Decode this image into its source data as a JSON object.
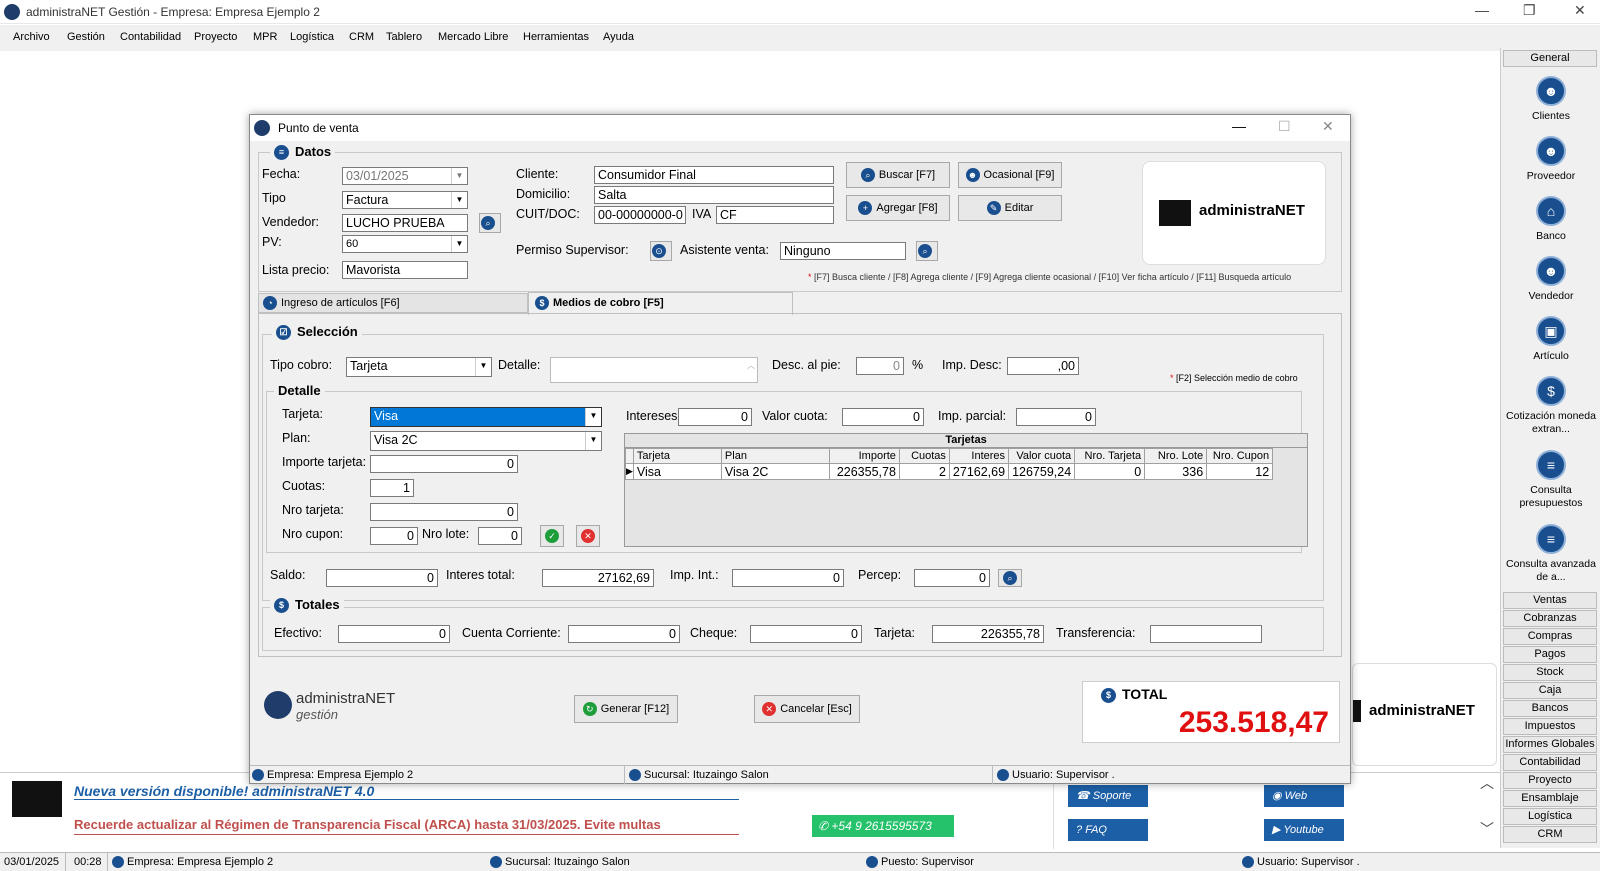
{
  "app": {
    "title": "administraNET Gestión - Empresa: Empresa Ejemplo 2"
  },
  "menu": [
    "Archivo",
    "Gestión",
    "Contabilidad",
    "Proyecto",
    "MPR",
    "Logística",
    "CRM",
    "Tablero",
    "Mercado Libre",
    "Herramientas",
    "Ayuda"
  ],
  "sidebar": {
    "header": "General",
    "items": [
      {
        "label": "Clientes"
      },
      {
        "label": "Proveedor"
      },
      {
        "label": "Banco"
      },
      {
        "label": "Vendedor"
      },
      {
        "label": "Artículo"
      },
      {
        "label": "Cotización moneda extran..."
      },
      {
        "label": "Consulta presupuestos"
      },
      {
        "label": "Consulta avanzada de a..."
      }
    ],
    "buttons": [
      "Ventas",
      "Cobranzas",
      "Compras",
      "Pagos",
      "Stock",
      "Caja",
      "Bancos",
      "Impuestos",
      "Informes Globales",
      "Contabilidad",
      "Proyecto",
      "Ensamblaje",
      "Logística",
      "CRM"
    ]
  },
  "window": {
    "title": "Punto de venta"
  },
  "datos": {
    "section": "Datos",
    "fecha_label": "Fecha:",
    "fecha": "03/01/2025",
    "tipo_label": "Tipo",
    "tipo": "Factura",
    "vendedor_label": "Vendedor:",
    "vendedor": "LUCHO PRUEBA",
    "pv_label": "PV:",
    "pv": "60",
    "lista_label": "Lista precio:",
    "lista": "Mavorista",
    "cliente_label": "Cliente:",
    "cliente": "Consumidor Final",
    "domicilio_label": "Domicilio:",
    "domicilio": "Salta",
    "cuit_label": "CUIT/DOC:",
    "cuit": "00-00000000-0",
    "iva_label": "IVA",
    "iva": "CF",
    "permiso_label": "Permiso Supervisor:",
    "asistente_label": "Asistente venta:",
    "asistente": "Ninguno",
    "btn_buscar": "Buscar [F7]",
    "btn_ocasional": "Ocasional [F9]",
    "btn_agregar": "Agregar [F8]",
    "btn_editar": "Editar",
    "hint": "[F7] Busca cliente / [F8] Agrega cliente / [F9] Agrega cliente ocasional / [F10] Ver ficha artículo / [F11] Busqueda artículo",
    "logo": "administraNET"
  },
  "tabs": [
    {
      "label": "Ingreso de artículos [F6]"
    },
    {
      "label": "Medios de cobro [F5]"
    }
  ],
  "seleccion": {
    "section": "Selección",
    "tipo_cobro_label": "Tipo cobro:",
    "tipo_cobro": "Tarjeta",
    "detalle_label": "Detalle:",
    "desc_label": "Desc. al pie:",
    "desc": "0",
    "pct": "%",
    "imp_desc_label": "Imp. Desc:",
    "imp_desc": ",00",
    "hint": "[F2] Selección medio de cobro"
  },
  "detalle": {
    "section": "Detalle",
    "tarjeta_label": "Tarjeta:",
    "tarjeta": "Visa",
    "plan_label": "Plan:",
    "plan": "Visa 2C",
    "importe_label": "Importe tarjeta:",
    "importe": "0",
    "cuotas_label": "Cuotas:",
    "cuotas": "1",
    "nro_tarjeta_label": "Nro tarjeta:",
    "nro_tarjeta": "0",
    "nro_cupon_label": "Nro cupon:",
    "nro_cupon": "0",
    "nro_lote_label": "Nro lote:",
    "nro_lote": "0",
    "intereses_label": "Intereses:",
    "intereses": "0",
    "valor_cuota_label": "Valor cuota:",
    "valor_cuota": "0",
    "imp_parcial_label": "Imp. parcial:",
    "imp_parcial": "0"
  },
  "tarjetas_table": {
    "title": "Tarjetas",
    "columns": [
      "Tarjeta",
      "Plan",
      "Importe",
      "Cuotas",
      "Interes",
      "Valor cuota",
      "Nro. Tarjeta",
      "Nro. Lote",
      "Nro. Cupon"
    ],
    "rows": [
      [
        "Visa",
        "Visa 2C",
        "226355,78",
        "2",
        "27162,69",
        "126759,24",
        "0",
        "336",
        "12"
      ]
    ]
  },
  "saldo": {
    "saldo_label": "Saldo:",
    "saldo": "0",
    "interes_total_label": "Interes total:",
    "interes_total": "27162,69",
    "imp_int_label": "Imp. Int.:",
    "imp_int": "0",
    "percep_label": "Percep:",
    "percep": "0"
  },
  "totales": {
    "section": "Totales",
    "efectivo_label": "Efectivo:",
    "efectivo": "0",
    "cc_label": "Cuenta Corriente:",
    "cc": "0",
    "cheque_label": "Cheque:",
    "cheque": "0",
    "tarjeta_label": "Tarjeta:",
    "tarjeta": "226355,78",
    "transferencia_label": "Transferencia:",
    "transferencia": ""
  },
  "footer": {
    "logo_top": "administraNET",
    "logo_bottom": "gestión",
    "btn_generar": "Generar [F12]",
    "btn_cancelar": "Cancelar [Esc]",
    "total_label": "TOTAL",
    "total": "253.518,47"
  },
  "window_status": {
    "empresa": "Empresa: Empresa Ejemplo 2",
    "sucursal": "Sucursal: Ituzaingo Salon",
    "usuario": "Usuario: Supervisor ."
  },
  "bg_logo": "administraNET",
  "news": {
    "title": "Nueva versión disponible! administraNET 4.0",
    "arca": "Recuerde actualizar al Régimen de Transparencia Fiscal (ARCA) hasta 31/03/2025. Evite multas",
    "whatsapp": "+54 9 2615595573",
    "links": [
      "Soporte",
      "Web",
      "FAQ",
      "Youtube"
    ]
  },
  "statusbar": {
    "date": "03/01/2025",
    "time": "00:28",
    "empresa": "Empresa: Empresa Ejemplo 2",
    "sucursal": "Sucursal: Ituzaingo Salon",
    "puesto": "Puesto: Supervisor",
    "usuario": "Usuario: Supervisor ."
  },
  "colors": {
    "accent": "#1a4f8f",
    "total": "#e01010",
    "arca": "#c0504d",
    "whatsapp": "#25c26b",
    "selection": "#0078d7"
  }
}
